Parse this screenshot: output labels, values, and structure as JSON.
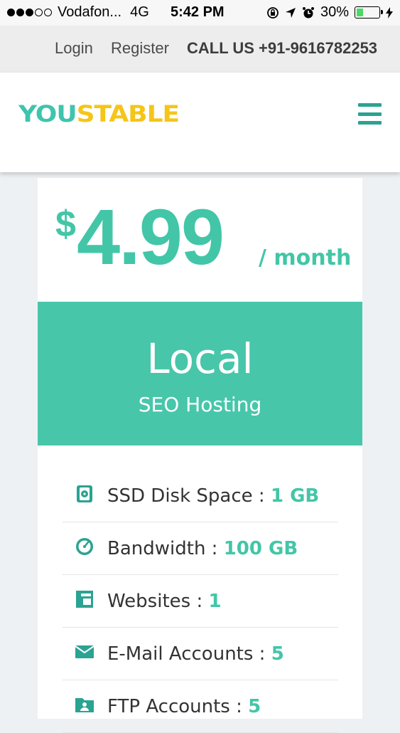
{
  "status_bar": {
    "carrier": "Vodafon...",
    "network": "4G",
    "time": "5:42 PM",
    "battery": "30%",
    "battery_level": 0.3
  },
  "top_bar": {
    "login_label": "Login",
    "register_label": "Register",
    "call_label": "CALL US +91-9616782253"
  },
  "header": {
    "logo_part1": "YOU",
    "logo_part2": "STABLE",
    "menu_icon": "hamburger-icon"
  },
  "pricing": {
    "currency": "$",
    "amount": "4.99",
    "period": "/ month",
    "plan_name": "Local",
    "plan_subtitle": "SEO Hosting"
  },
  "features": [
    {
      "icon": "disk-icon",
      "label": "SSD Disk Space : ",
      "value": "1 GB"
    },
    {
      "icon": "speedometer-icon",
      "label": "Bandwidth : ",
      "value": "100 GB"
    },
    {
      "icon": "layout-icon",
      "label": "Websites : ",
      "value": "1"
    },
    {
      "icon": "envelope-icon",
      "label": "E-Mail Accounts : ",
      "value": "5"
    },
    {
      "icon": "folder-user-icon",
      "label": "FTP Accounts : ",
      "value": "5"
    }
  ],
  "colors": {
    "accent": "#42c6a7",
    "logo_yellow": "#f5c518"
  }
}
